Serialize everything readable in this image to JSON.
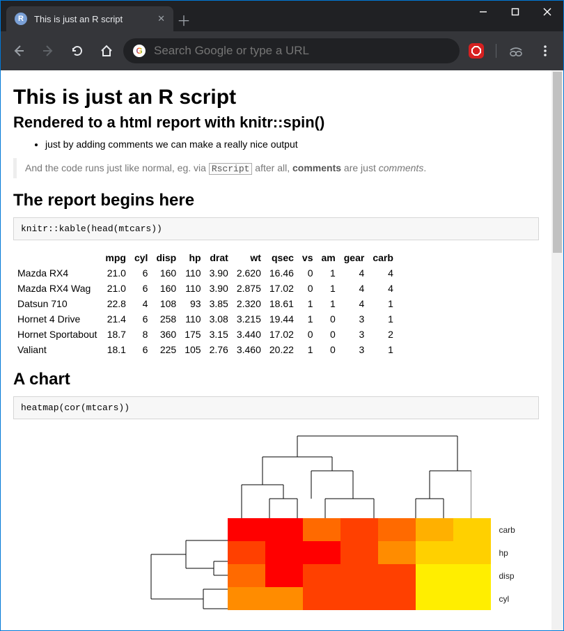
{
  "window": {
    "tab_title": "This is just an R script",
    "favicon_letter": "R"
  },
  "toolbar": {
    "omnibox_placeholder": "Search Google or type a URL"
  },
  "doc": {
    "h1": "This is just an R script",
    "h2_sub": "Rendered to a html report with knitr::spin()",
    "bullet1": "just by adding comments we can make a really nice output",
    "quote_pre": "And the code runs just like normal, eg. via ",
    "quote_code": "Rscript",
    "quote_mid": " after all, ",
    "quote_bold": "comments",
    "quote_post1": " are just ",
    "quote_em": "comments",
    "quote_post2": ".",
    "h2_report": "The report begins here",
    "code1": "knitr::kable(head(mtcars))",
    "h2_chart": "A chart",
    "code2": "heatmap(cor(mtcars))"
  },
  "table": {
    "headers": [
      "mpg",
      "cyl",
      "disp",
      "hp",
      "drat",
      "wt",
      "qsec",
      "vs",
      "am",
      "gear",
      "carb"
    ],
    "rows": [
      {
        "name": "Mazda RX4",
        "cells": [
          "21.0",
          "6",
          "160",
          "110",
          "3.90",
          "2.620",
          "16.46",
          "0",
          "1",
          "4",
          "4"
        ]
      },
      {
        "name": "Mazda RX4 Wag",
        "cells": [
          "21.0",
          "6",
          "160",
          "110",
          "3.90",
          "2.875",
          "17.02",
          "0",
          "1",
          "4",
          "4"
        ]
      },
      {
        "name": "Datsun 710",
        "cells": [
          "22.8",
          "4",
          "108",
          "93",
          "3.85",
          "2.320",
          "18.61",
          "1",
          "1",
          "4",
          "1"
        ]
      },
      {
        "name": "Hornet 4 Drive",
        "cells": [
          "21.4",
          "6",
          "258",
          "110",
          "3.08",
          "3.215",
          "19.44",
          "1",
          "0",
          "3",
          "1"
        ]
      },
      {
        "name": "Hornet Sportabout",
        "cells": [
          "18.7",
          "8",
          "360",
          "175",
          "3.15",
          "3.440",
          "17.02",
          "0",
          "0",
          "3",
          "2"
        ]
      },
      {
        "name": "Valiant",
        "cells": [
          "18.1",
          "6",
          "225",
          "105",
          "2.76",
          "3.460",
          "20.22",
          "1",
          "0",
          "3",
          "1"
        ]
      }
    ]
  },
  "chart_data": {
    "type": "heatmap",
    "title": "",
    "row_labels_visible": [
      "carb",
      "hp",
      "disp",
      "cyl"
    ],
    "note": "Partial heatmap of cor(mtcars) with dendrograms; colors are correlation magnitudes",
    "palette": [
      "#ff0000",
      "#ff4000",
      "#ff6a00",
      "#ff8c00",
      "#ffb000",
      "#ffd000",
      "#ffee00",
      "#ffff66",
      "#ffffcc"
    ],
    "cells": [
      [
        0,
        0,
        2,
        1,
        2,
        4,
        5,
        6,
        8
      ],
      [
        1,
        0,
        0,
        1,
        3,
        5,
        5,
        6,
        6
      ],
      [
        2,
        0,
        1,
        1,
        1,
        6,
        6,
        6,
        6
      ],
      [
        3,
        3,
        1,
        1,
        1,
        6,
        6,
        6,
        6
      ]
    ]
  }
}
